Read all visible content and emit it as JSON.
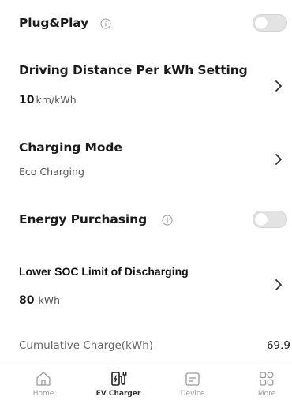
{
  "plug_play": {
    "label": "Plug&Play",
    "info_icon": "info-icon",
    "toggle_on": false
  },
  "driving_distance": {
    "title": "Driving Distance Per kWh Setting",
    "value": "10",
    "unit": "km/kWh",
    "icon": "chevron-right-icon"
  },
  "charging_mode": {
    "title": "Charging Mode",
    "value": "Eco Charging",
    "icon": "chevron-right-icon"
  },
  "energy_purchasing": {
    "label": "Energy Purchasing",
    "info_icon": "info-icon",
    "toggle_on": false
  },
  "lower_soc": {
    "title": "Lower SOC Limit of Discharging",
    "value": "80",
    "unit": "kWh",
    "icon": "chevron-right-icon"
  },
  "cumulative_charge": {
    "label": "Cumulative Charge(kWh)",
    "value": "69.9"
  },
  "tabbar": {
    "tabs": [
      {
        "label": "Home",
        "icon": "home-icon",
        "active": false
      },
      {
        "label": "EV Charger",
        "icon": "ev-charger-icon",
        "active": true
      },
      {
        "label": "Device",
        "icon": "device-icon",
        "active": false
      },
      {
        "label": "More",
        "icon": "grid-icon",
        "active": false
      }
    ]
  },
  "colors": {
    "toggle_off": "#e3e3e3",
    "text_primary": "#1b1b1b",
    "text_secondary": "#555555",
    "tab_inactive": "#9a9a9a"
  }
}
